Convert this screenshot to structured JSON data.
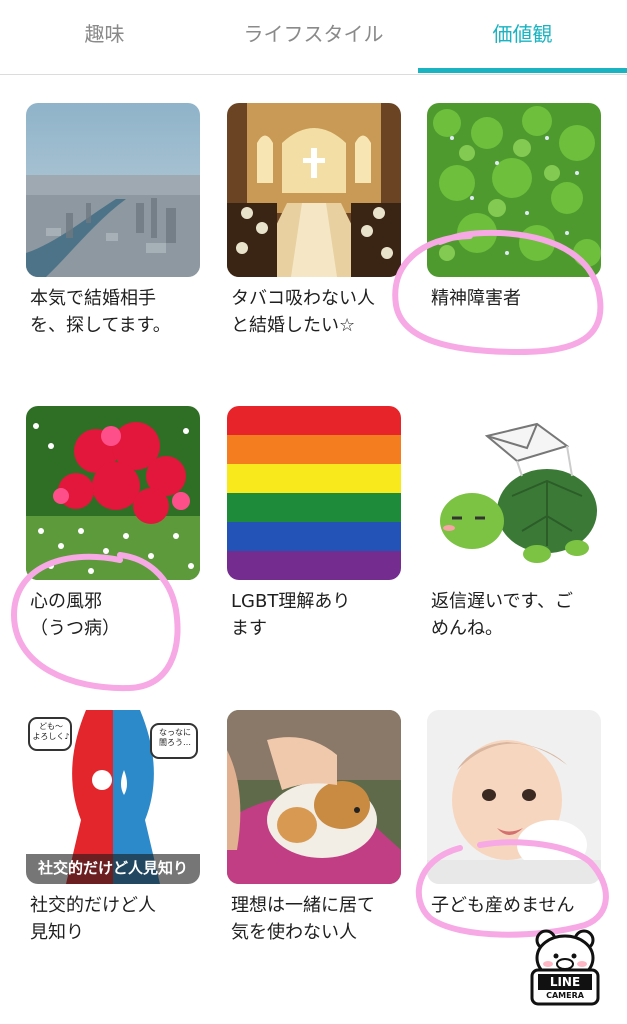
{
  "tabs": [
    {
      "label": "趣味",
      "active": false
    },
    {
      "label": "ライフスタイル",
      "active": false
    },
    {
      "label": "価値観",
      "active": true
    }
  ],
  "accent_color": "#19b3c2",
  "annotation_color": "#f6a9e4",
  "cards": [
    {
      "label": "本気で結婚相手\nを、探してます。",
      "image": "city-aerial-photo"
    },
    {
      "label": "タバコ吸わない人\nと結婚したい☆",
      "image": "wedding-chapel-photo"
    },
    {
      "label": "精神障害者",
      "image": "green-flower-field-photo"
    },
    {
      "label": "心の風邪\n（うつ病）",
      "image": "red-flowers-photo"
    },
    {
      "label": "LGBT理解あり\nます",
      "image": "rainbow-flag"
    },
    {
      "label": "返信遅いです、ご\nめんね。",
      "image": "turtle-with-envelope-illustration"
    },
    {
      "label": "社交的だけど人\n見知り",
      "image": "introvert-extrovert-illustration"
    },
    {
      "label": "理想は一緒に居て\n気を使わない人",
      "image": "guinea-pig-photo"
    },
    {
      "label": "子ども産めません",
      "image": "baby-photo"
    }
  ],
  "illustration_texts": {
    "bubble_left": "ども〜\nよろしく♪",
    "bubble_right": "なっなに\n闇ろう…",
    "caption": "社交的だけど人見知り"
  },
  "watermark": {
    "line1": "LINE",
    "line2": "CAMERA"
  }
}
